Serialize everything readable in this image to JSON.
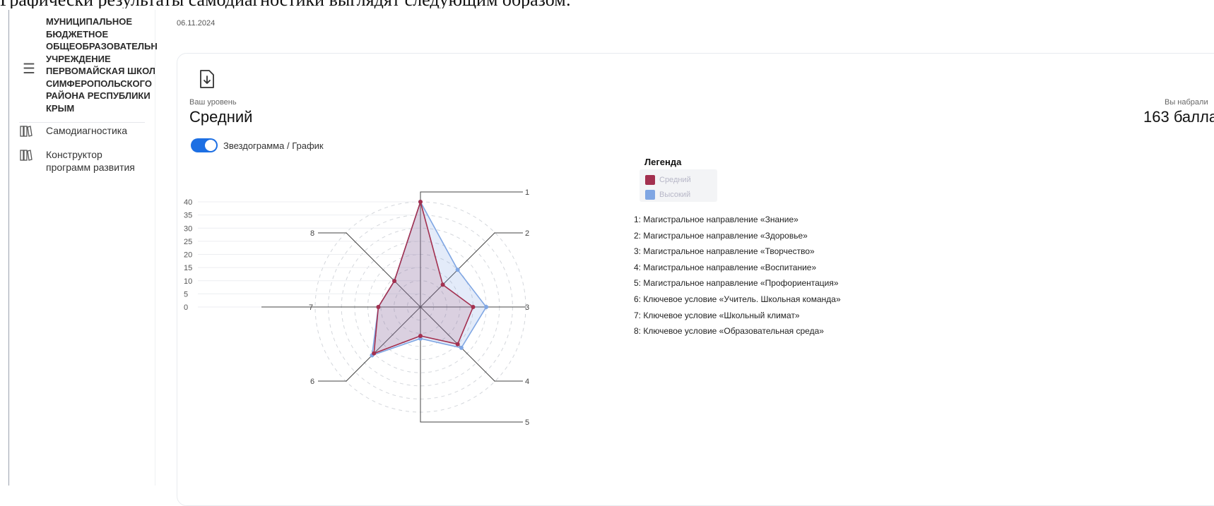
{
  "doc_title": "Графически результаты самодиагностики выглядят следующим образом:",
  "sidebar": {
    "org_name": "МУНИЦИПАЛЬНОЕ\nБЮДЖЕТНОЕ\nОБЩЕОБРАЗОВАТЕЛЬН\nУЧРЕЖДЕНИЕ\nПЕРВОМАЙСКАЯ ШКОЛ\nСИМФЕРОПОЛЬСКОГО\nРАЙОНА РЕСПУБЛИКИ\nКРЫМ",
    "menu_icon": "hamburger-icon",
    "items": [
      {
        "label": "Самодиагностика",
        "icon": "books-icon"
      },
      {
        "label": "Конструктор\nпрограмм развития",
        "icon": "books-icon"
      }
    ]
  },
  "date": "06.11.2024",
  "level": {
    "caption": "Ваш уровень",
    "value": "Средний"
  },
  "score": {
    "caption": "Вы набрали",
    "value": "163 балла"
  },
  "toggle": {
    "label": "Звездограмма / График",
    "on": true
  },
  "colors": {
    "accent": "#1d6fe3",
    "series1": "#a3304f",
    "series2": "#7fa6e3"
  },
  "chart_data": {
    "type": "radar",
    "legend_title": "Легенда",
    "axes": [
      "1",
      "2",
      "3",
      "4",
      "5",
      "6",
      "7",
      "8"
    ],
    "scale_ticks": [
      "40",
      "35",
      "30",
      "25",
      "20",
      "15",
      "10",
      "5",
      "0"
    ],
    "rlim": [
      0,
      40
    ],
    "series": [
      {
        "name": "Средний",
        "values": [
          40,
          12,
          20,
          20,
          11,
          25,
          16,
          14
        ]
      },
      {
        "name": "Высокий",
        "values": [
          40,
          20,
          25,
          22,
          12,
          26,
          16,
          14
        ]
      }
    ],
    "axis_descriptions": [
      "1: Магистральное направление «Знание»",
      "2: Магистральное направление «Здоровье»",
      "3: Магистральное направление «Творчество»",
      "4: Магистральное направление «Воспитание»",
      "5: Магистральное направление «Профориентация»",
      "6: Ключевое условие «Учитель. Школьная команда»",
      "7: Ключевое условие «Школьный климат»",
      "8: Ключевое условие «Образовательная среда»"
    ]
  }
}
